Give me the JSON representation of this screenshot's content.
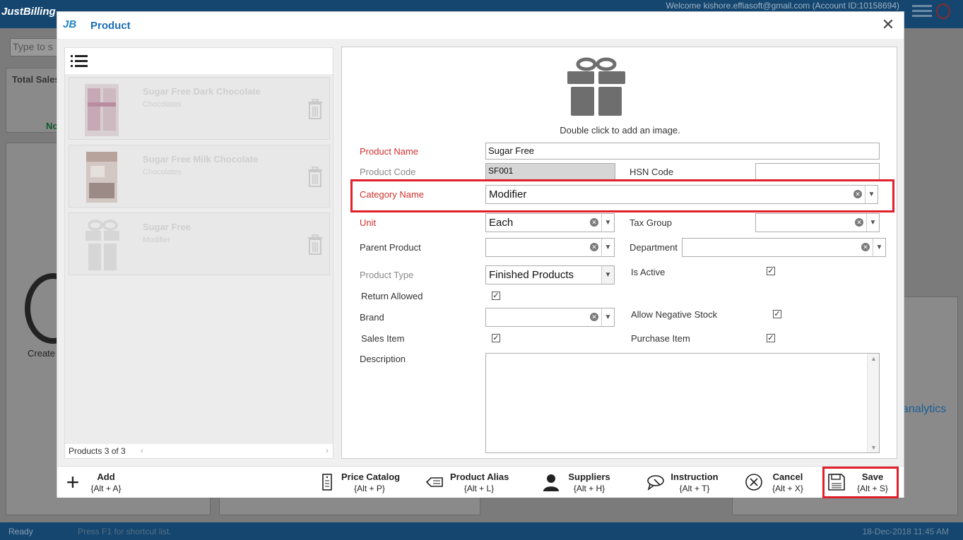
{
  "app": {
    "logo": "JustBilling",
    "welcome": "Welcome kishore.effiasoft@gmail.com (Account ID:10158694)",
    "search_placeholder": "Type to s",
    "total_sales_label": "Total Sales",
    "create_label": "Create",
    "analytics_label": "analytics",
    "no_label": "No",
    "status_ready": "Ready",
    "status_hint": "Press F1 for shortcut list.",
    "status_datetime": "18-Dec-2018 11:45 AM"
  },
  "dialog": {
    "logo": "JB",
    "title": "Product"
  },
  "list": {
    "items": [
      {
        "name": "Sugar Free Dark Chocolate",
        "category": "Chocolates"
      },
      {
        "name": "Sugar Free Milk Chocolate",
        "category": "Chocolates"
      },
      {
        "name": "Sugar Free",
        "category": "Modifier"
      }
    ],
    "footer": "Products 3 of 3"
  },
  "form": {
    "image_hint": "Double click to add an image.",
    "product_name_label": "Product Name",
    "product_name_value": "Sugar Free",
    "product_code_label": "Product Code",
    "product_code_value": "SF001",
    "hsn_code_label": "HSN Code",
    "hsn_code_value": "",
    "category_label": "Category Name",
    "category_value": "Modifier",
    "unit_label": "Unit",
    "unit_value": "Each",
    "tax_group_label": "Tax Group",
    "tax_group_value": "",
    "parent_product_label": "Parent Product",
    "parent_product_value": "",
    "department_label": "Department",
    "department_value": "",
    "product_type_label": "Product Type",
    "product_type_value": "Finished Products",
    "is_active_label": "Is Active",
    "is_active": true,
    "return_allowed_label": "Return Allowed",
    "return_allowed": true,
    "brand_label": "Brand",
    "brand_value": "",
    "allow_negative_label": "Allow Negative Stock",
    "allow_negative": true,
    "sales_item_label": "Sales Item",
    "sales_item": true,
    "purchase_item_label": "Purchase Item",
    "purchase_item": true,
    "description_label": "Description",
    "description_value": ""
  },
  "toolbar": {
    "add": {
      "label": "Add",
      "key": "{Alt + A}"
    },
    "price_catalog": {
      "label": "Price Catalog",
      "key": "{Alt + P}"
    },
    "product_alias": {
      "label": "Product Alias",
      "key": "{Alt + L}"
    },
    "suppliers": {
      "label": "Suppliers",
      "key": "{Alt + H}"
    },
    "instruction": {
      "label": "Instruction",
      "key": "{Alt + T}"
    },
    "cancel": {
      "label": "Cancel",
      "key": "{Alt + X}"
    },
    "save": {
      "label": "Save",
      "key": "{Alt + S}"
    }
  },
  "colors": {
    "required_label": "#d0312d",
    "title_blue": "#1c6fb3",
    "highlight": "#e0202a"
  }
}
